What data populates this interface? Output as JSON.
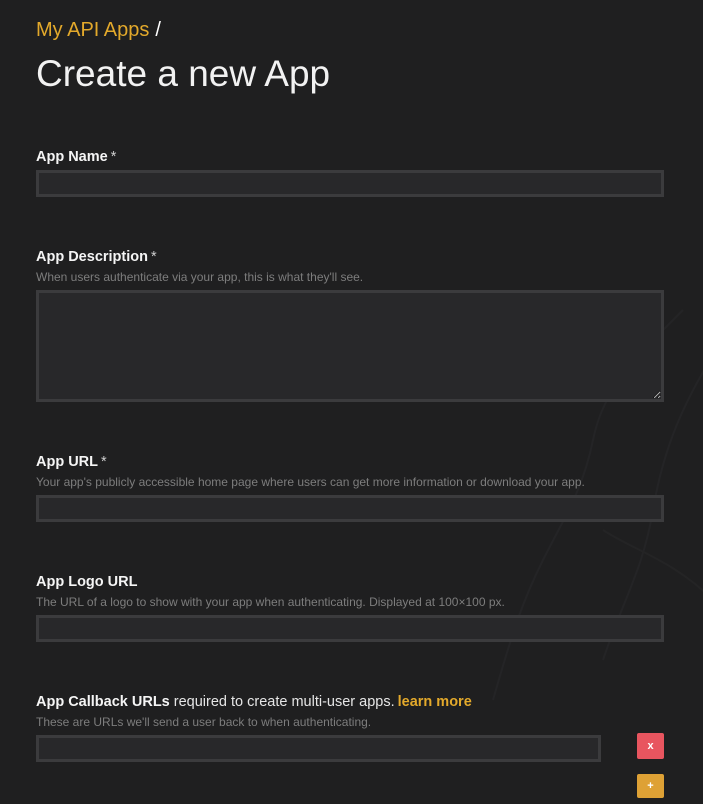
{
  "breadcrumb": {
    "parent_link": "My API Apps",
    "separator": "/"
  },
  "page_title": "Create a new App",
  "form": {
    "app_name": {
      "label": "App Name",
      "required_mark": "*",
      "value": ""
    },
    "app_description": {
      "label": "App Description",
      "required_mark": "*",
      "help": "When users authenticate via your app, this is what they'll see.",
      "value": ""
    },
    "app_url": {
      "label": "App URL",
      "required_mark": "*",
      "help": "Your app's publicly accessible home page where users can get more information or download your app.",
      "value": ""
    },
    "app_logo_url": {
      "label": "App Logo URL",
      "help": "The URL of a logo to show with your app when authenticating. Displayed at 100×100 px.",
      "value": ""
    },
    "app_callback_urls": {
      "label": "App Callback URLs",
      "label_suffix": "required to create multi-user apps.",
      "learn_more": "learn more",
      "help": "These are URLs we'll send a user back to when authenticating.",
      "value": "",
      "remove_label": "x",
      "add_label": "+"
    }
  },
  "colors": {
    "background": "#1f1f20",
    "accent": "#e3a92b",
    "input_bg": "#28282a",
    "input_border": "#3b3b3d",
    "remove_button": "#e8555f",
    "add_button": "#dea135",
    "help_text": "#7d7d7d"
  }
}
